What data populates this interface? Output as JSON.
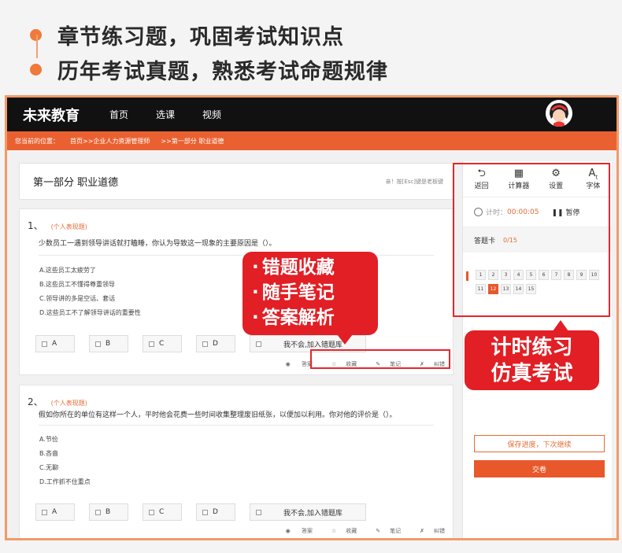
{
  "promo": {
    "items": [
      "章节练习题，巩固考试知识点",
      "历年考试真题，熟悉考试命题规律"
    ]
  },
  "header": {
    "logo": "未来教育",
    "nav": [
      "首页",
      "选课",
      "视频"
    ]
  },
  "breadcrumb": {
    "prefix": "您当前的位置：",
    "path1": "首页>>企业人力资源管理师",
    "path2": ">>第一部分 职业道德"
  },
  "section": {
    "title": "第一部分 职业道德",
    "tip": "亲！按[Esc]键是老板键"
  },
  "questions": [
    {
      "num": "1、",
      "type": "(个人表现题)",
      "stem": "少数员工一遇到领导讲话就打瞌睡，你认为导致这一现象的主要原因是（）。",
      "options": [
        "A.这些员工太疲劳了",
        "B.这些员工不懂得尊重领导",
        "C.领导讲的多是空话、套话",
        "D.这些员工不了解领导讲话的重要性"
      ],
      "answers": [
        "A",
        "B",
        "C",
        "D"
      ],
      "wrong_label": "我不会,加入错题库",
      "tools": [
        "答案",
        "收藏",
        "笔记",
        "纠错"
      ]
    },
    {
      "num": "2、",
      "type": "(个人表现题)",
      "stem": "假如你所在的单位有这样一个人，平时他会花费一些时间收集整理废旧纸张，以便加以利用。你对他的评价是（）。",
      "options": [
        "A.节俭",
        "B.吝啬",
        "C.无聊",
        "D.工作抓不住重点"
      ],
      "answers": [
        "A",
        "B",
        "C",
        "D"
      ],
      "wrong_label": "我不会,加入错题库",
      "tools": [
        "答案",
        "收藏",
        "笔记",
        "纠错"
      ]
    }
  ],
  "sidebar": {
    "toolbar": [
      {
        "label": "返回",
        "icon": "back-icon"
      },
      {
        "label": "计算器",
        "icon": "calculator-icon"
      },
      {
        "label": "设置",
        "icon": "gear-icon"
      },
      {
        "label": "字体",
        "icon": "font-icon"
      }
    ],
    "timer_label": "计时：",
    "timer_value": "00:00:05",
    "pause_label": "暂停",
    "answer_card_label": "答题卡",
    "answer_card_count": "0/15",
    "cells": [
      "1",
      "2",
      "3",
      "4",
      "5",
      "6",
      "7",
      "8",
      "9",
      "10",
      "11",
      "12",
      "13",
      "14",
      "15"
    ],
    "current_cell": "12",
    "save_label": "保存进度，下次继续",
    "submit_label": "交卷"
  },
  "annotations": {
    "callout1": [
      "错题收藏",
      "随手笔记",
      "答案解析"
    ],
    "callout2": [
      "计时练习",
      "仿真考试"
    ],
    "accent": "#e11f25"
  }
}
